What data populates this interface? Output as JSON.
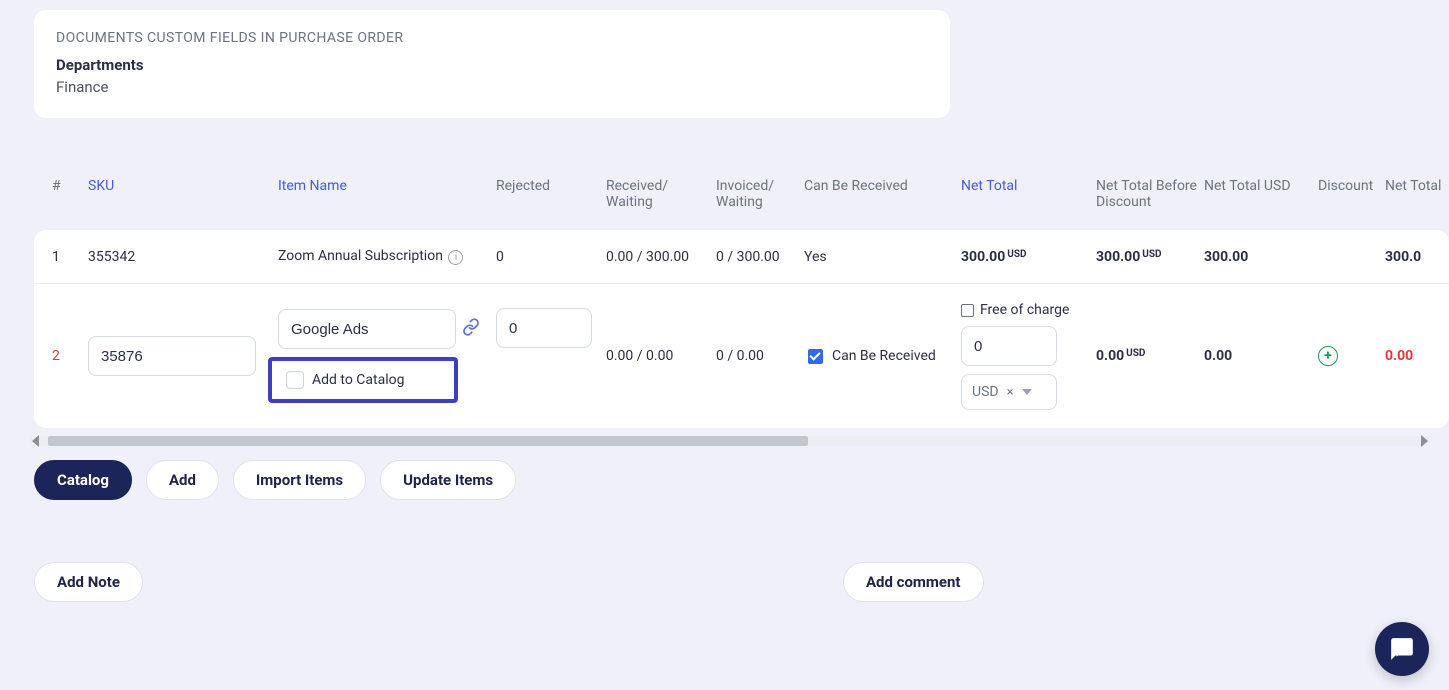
{
  "custom_fields_card": {
    "title": "DOCUMENTS CUSTOM FIELDS IN PURCHASE ORDER",
    "field_label": "Departments",
    "field_value": "Finance"
  },
  "columns": {
    "idx": "#",
    "sku": "SKU",
    "name": "Item Name",
    "rejected": "Rejected",
    "received_waiting": "Received/ Waiting",
    "invoiced_waiting": "Invoiced/ Waiting",
    "can_be_received": "Can Be Received",
    "net_total": "Net Total",
    "net_total_before_discount": "Net Total Before Discount",
    "net_total_usd": "Net Total USD",
    "discount": "Discount",
    "net_total_after_d": "Net Total After D"
  },
  "rows": [
    {
      "idx": "1",
      "sku": "355342",
      "name": "Zoom Annual Subscription",
      "rejected": "0",
      "received_waiting": "0.00 / 300.00",
      "invoiced_waiting": "0 / 300.00",
      "can_be_received": "Yes",
      "net_total_value": "300.00",
      "net_total_currency": "USD",
      "net_total_before_value": "300.00",
      "net_total_before_currency": "USD",
      "net_total_usd": "300.00",
      "net_total_after_d": "300.0"
    },
    {
      "idx": "2",
      "sku": "35876",
      "name": "Google Ads",
      "add_to_catalog_label": "Add to Catalog",
      "free_of_charge_label": "Free of charge",
      "rejected": "0",
      "received_waiting": "0.00 / 0.00",
      "invoiced_waiting": "0 / 0.00",
      "can_be_received_label": "Can Be Received",
      "net_total_value": "0",
      "net_total_currency_label": "USD",
      "net_before_value": "0.00",
      "net_before_currency": "USD",
      "net_total_usd": "0.00",
      "net_total_after_d": "0.00"
    }
  ],
  "buttons": {
    "catalog": "Catalog",
    "add": "Add",
    "import_items": "Import Items",
    "update_items": "Update Items",
    "add_note": "Add Note",
    "add_comment": "Add comment"
  }
}
